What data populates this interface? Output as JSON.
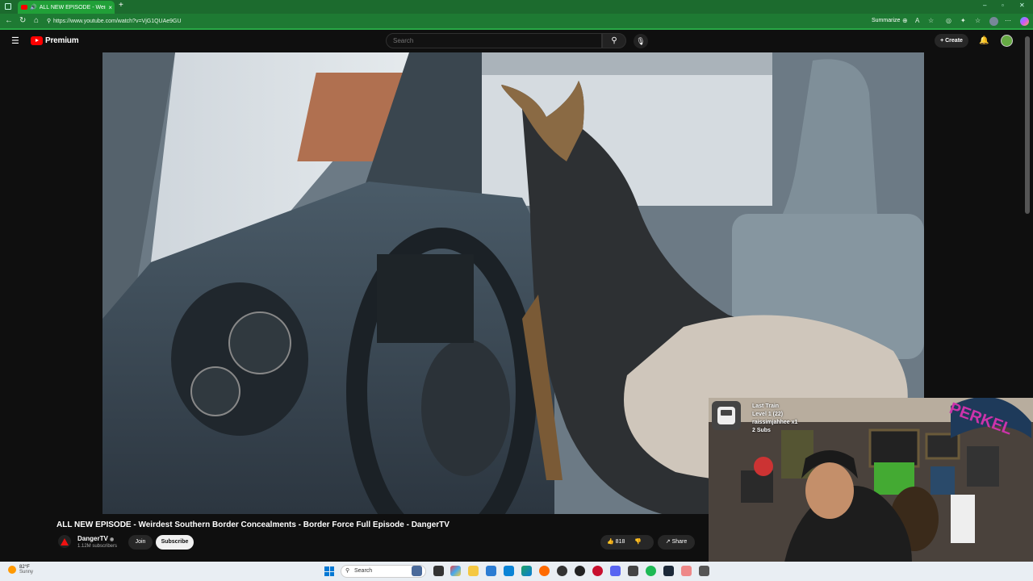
{
  "browser": {
    "tab_title": "ALL NEW EPISODE - Weirdest",
    "url": "https://www.youtube.com/watch?v=VjG1QUAe9GU",
    "summarize_label": "Summarize"
  },
  "youtube": {
    "logo_text": "Premium",
    "search_placeholder": "Search",
    "create_label": "Create"
  },
  "video": {
    "title": "ALL NEW EPISODE - Weirdest Southern Border Concealments - Border Force Full Episode - DangerTV",
    "channel_name": "DangerTV",
    "subscribers": "1.12M subscribers",
    "join_label": "Join",
    "subscribe_label": "Subscribe",
    "likes": "818",
    "share_label": "Share"
  },
  "stream_overlay": {
    "line1": "Last Train",
    "line2": "Level 1  (22)",
    "line3": "raissimjahhee x1",
    "line4": "2 Subs"
  },
  "taskbar": {
    "temperature": "82°F",
    "condition": "Sunny",
    "search_label": "Search"
  },
  "colors": {
    "browser_frame": "#1c6b2e",
    "yt_red": "#ff0000",
    "taskbar": "#e9eef3"
  }
}
